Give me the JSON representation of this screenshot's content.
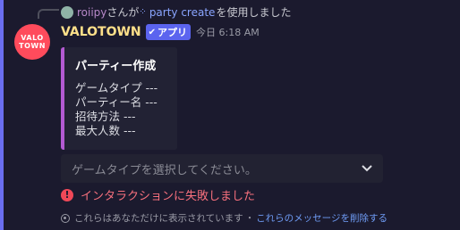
{
  "reply": {
    "user": "roiipy",
    "text_before": "さんが",
    "command": "party create",
    "text_after": "を使用しました"
  },
  "bot": {
    "avatar_text_1": "VALO",
    "avatar_text_2": "TOWN",
    "name": "VALOTOWN",
    "badge": "アプリ",
    "timestamp": "今日 6:18 AM"
  },
  "embed": {
    "title": "パーティー作成",
    "fields": [
      "ゲームタイプ ---",
      "パーティー名 ---",
      "招待方法 ---",
      "最大人数 ---"
    ]
  },
  "select": {
    "placeholder": "ゲームタイプを選択してください。"
  },
  "error": {
    "text": "インタラクションに失敗しました"
  },
  "ephemeral": {
    "text": "これらはあなただけに表示されています",
    "separator": "・",
    "link": "これらのメッセージを削除する"
  },
  "colors": {
    "accent": "#5b64ef",
    "embed_border": "#b35ad2",
    "bot_name": "#ffe08a",
    "error": "#f04858"
  }
}
